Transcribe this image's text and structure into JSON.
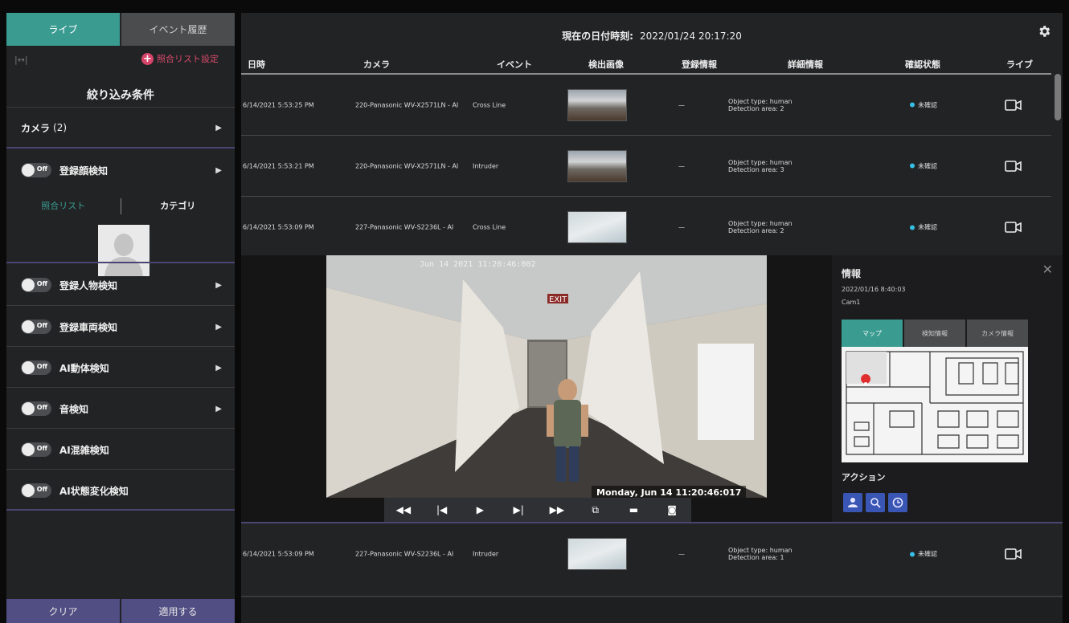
{
  "sidebar": {
    "tabs": [
      {
        "label": "ライブ"
      },
      {
        "label": "イベント履歴"
      }
    ],
    "expand_icon": "|↔|",
    "match_list_settings": "照合リスト設定",
    "filter_title": "絞り込み条件",
    "camera_row": {
      "label": "カメラ",
      "count": "(2)"
    },
    "toggle_off_label": "Off",
    "filters": [
      {
        "label": "登録顔検知"
      },
      {
        "label": "登録人物検知"
      },
      {
        "label": "登録車両検知"
      },
      {
        "label": "AI動体検知"
      },
      {
        "label": "音検知"
      },
      {
        "label": "AI混雑検知"
      },
      {
        "label": "AI状態変化検知"
      }
    ],
    "subtabs": {
      "match_list": "照合リスト",
      "category": "カテゴリ"
    },
    "buttons": {
      "clear": "クリア",
      "apply": "適用する"
    }
  },
  "header": {
    "datetime_label": "現在の日付時刻:",
    "datetime_value": "2022/01/24 20:17:20"
  },
  "table": {
    "columns": [
      "日時",
      "カメラ",
      "イベント",
      "検出画像",
      "登録情報",
      "詳細情報",
      "確認状態",
      "ライブ"
    ],
    "rows": [
      {
        "datetime": "6/14/2021 5:53:25 PM",
        "camera": "220-Panasonic WV-X2571LN - AI",
        "event": "Cross Line",
        "reg": "—",
        "detail1": "Object type: human",
        "detail2": "Detection area: 2",
        "status": "未確認"
      },
      {
        "datetime": "6/14/2021 5:53:21 PM",
        "camera": "220-Panasonic WV-X2571LN - AI",
        "event": "Intruder",
        "reg": "—",
        "detail1": "Object type: human",
        "detail2": "Detection area: 3",
        "status": "未確認"
      },
      {
        "datetime": "6/14/2021 5:53:09 PM",
        "camera": "227-Panasonic WV-S2236L - AI",
        "event": "Cross Line",
        "reg": "—",
        "detail1": "Object type: human",
        "detail2": "Detection area: 2",
        "status": "未確認"
      },
      {
        "datetime": "6/14/2021 5:53:09 PM",
        "camera": "227-Panasonic WV-S2236L - AI",
        "event": "Intruder",
        "reg": "—",
        "detail1": "Object type: human",
        "detail2": "Detection area: 1",
        "status": "未確認"
      }
    ]
  },
  "video": {
    "overlay_timestamp": "Jun 14 2021 11:20:46:002",
    "date_text": "Monday, Jun 14  11:20:46:017",
    "exit_sign": "EXIT",
    "controls": [
      "rewind-icon",
      "prev-frame-icon",
      "play-icon",
      "next-frame-icon",
      "fast-forward-icon",
      "external-icon",
      "clip-icon",
      "camera-icon"
    ]
  },
  "info": {
    "title": "情報",
    "date": "2022/01/16 8:40:03",
    "camera": "Cam1",
    "tabs": [
      "マップ",
      "検知情報",
      "カメラ情報"
    ],
    "actions_label": "アクション"
  },
  "colors": {
    "accent": "#3a9b91",
    "purple": "#514e84",
    "status": "#35c0e6",
    "pink": "#d8456a"
  }
}
